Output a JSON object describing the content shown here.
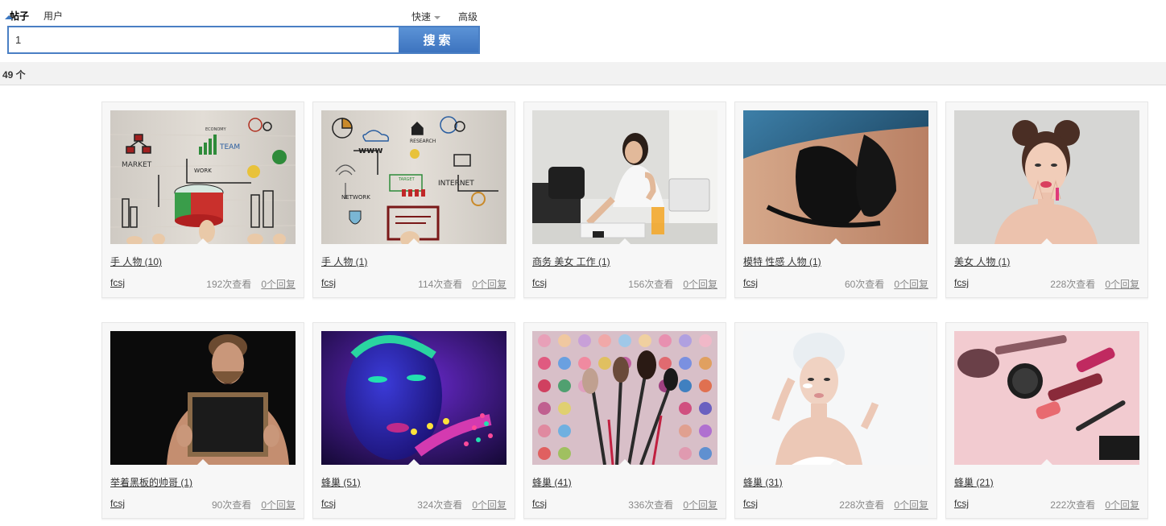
{
  "tabs": [
    {
      "label": "帖子",
      "active": true
    },
    {
      "label": "用户",
      "active": false
    }
  ],
  "search": {
    "quick_label": "快速",
    "advanced_label": "高级",
    "value": "1",
    "button_label": "搜索",
    "accent_color": "#3c78c1"
  },
  "results": {
    "count_label": "49 个"
  },
  "cards": [
    {
      "title": "手 人物 (10)",
      "author": "fcsj",
      "views": "192次查看",
      "replies": "0个回复",
      "image": "business-concept-sketch-image"
    },
    {
      "title": "手 人物 (1)",
      "author": "fcsj",
      "views": "114次查看",
      "replies": "0个回复",
      "image": "internet-concept-sketch-image"
    },
    {
      "title": "商务 美女 工作 (1)",
      "author": "fcsj",
      "views": "156次查看",
      "replies": "0个回复",
      "image": "woman-at-office-desk-image"
    },
    {
      "title": "模特 性感 人物 (1)",
      "author": "fcsj",
      "views": "60次查看",
      "replies": "0个回复",
      "image": "model-in-black-lingerie-image"
    },
    {
      "title": "美女 人物 (1)",
      "author": "fcsj",
      "views": "228次查看",
      "replies": "0个回复",
      "image": "woman-with-hair-buns-image"
    },
    {
      "title": "举着黑板的帅哥 (1)",
      "author": "fcsj",
      "views": "90次查看",
      "replies": "0个回复",
      "image": "man-holding-blackboard-image"
    },
    {
      "title": "蜂巢 (51)",
      "author": "fcsj",
      "views": "324次查看",
      "replies": "0个回复",
      "image": "neon-face-paint-image"
    },
    {
      "title": "蜂巢 (41)",
      "author": "fcsj",
      "views": "336次查看",
      "replies": "0个回复",
      "image": "makeup-brushes-palette-image"
    },
    {
      "title": "蜂巢 (31)",
      "author": "fcsj",
      "views": "228次查看",
      "replies": "0个回复",
      "image": "woman-with-towel-skincare-image"
    },
    {
      "title": "蜂巢 (21)",
      "author": "fcsj",
      "views": "222次查看",
      "replies": "0个回复",
      "image": "cosmetics-on-pink-image"
    }
  ]
}
